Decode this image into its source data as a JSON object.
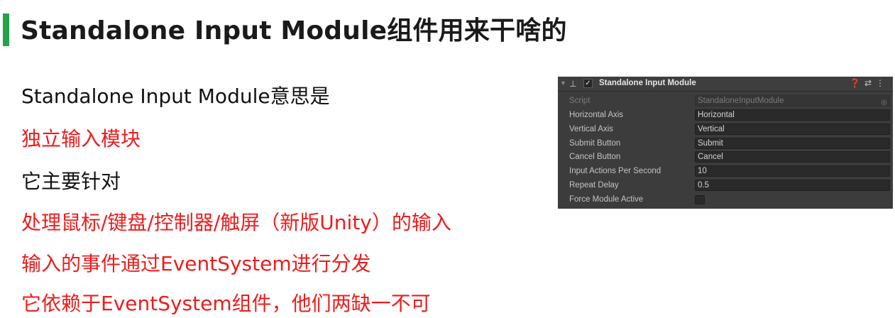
{
  "slide": {
    "title": "Standalone Input Module组件用来干啥的",
    "lines": [
      "Standalone Input Module意思是",
      "独立输入模块",
      "它主要针对",
      "处理鼠标/键盘/控制器/触屏（新版Unity）的输入",
      "输入的事件通过EventSystem进行分发",
      "它依赖于EventSystem组件，他们两缺一不可"
    ]
  },
  "inspector": {
    "component_name": "Standalone Input Module",
    "enabled_check": "✓",
    "header_icons": [
      "help-icon",
      "settings-icon",
      "more-icon"
    ],
    "script_label": "Script",
    "script_value": "StandaloneInputModule",
    "fields": [
      {
        "label": "Horizontal Axis",
        "value": "Horizontal"
      },
      {
        "label": "Vertical Axis",
        "value": "Vertical"
      },
      {
        "label": "Submit Button",
        "value": "Submit"
      },
      {
        "label": "Cancel Button",
        "value": "Cancel"
      },
      {
        "label": "Input Actions Per Second",
        "value": "10"
      },
      {
        "label": "Repeat Delay",
        "value": "0.5"
      }
    ],
    "force_label": "Force Module Active",
    "colors": {
      "panel": "#3c3c3c",
      "field": "#2a2a2a",
      "accent_green": "#22a34a",
      "red_text": "#ee1c1c"
    }
  }
}
